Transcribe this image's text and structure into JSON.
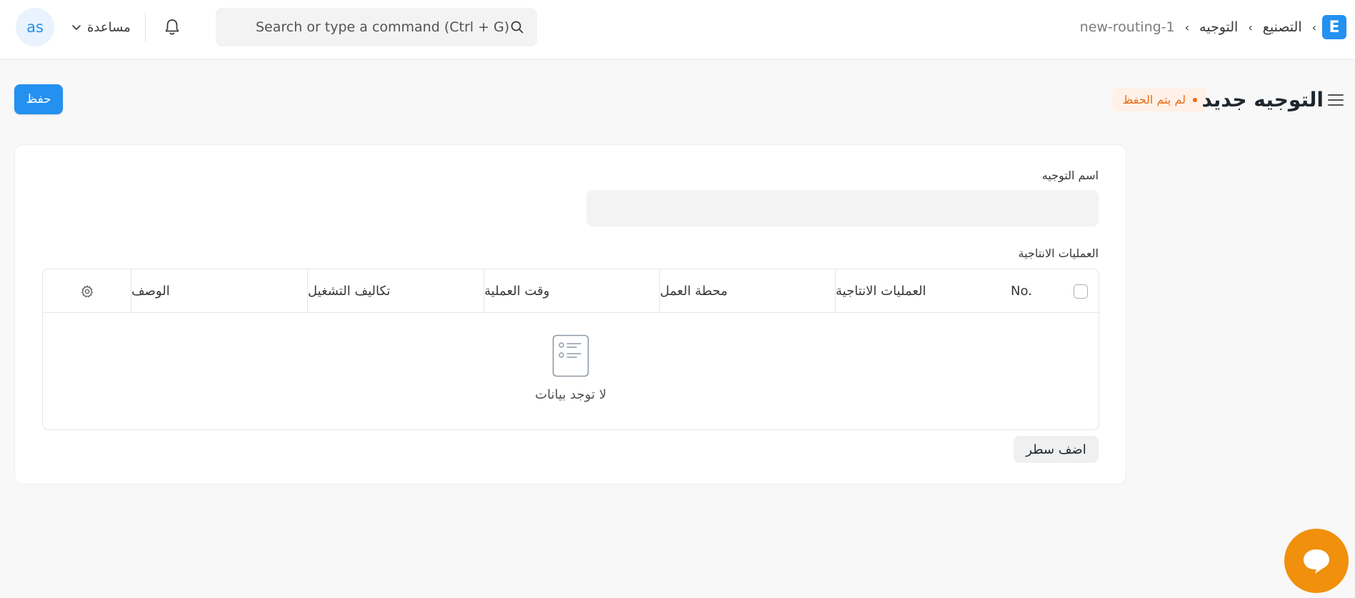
{
  "navbar": {
    "avatar_initials": "as",
    "help_label": "مساعدة",
    "search_placeholder": "Search or type a command (Ctrl + G)",
    "breadcrumbs": [
      "التصنيع",
      "التوجيه",
      "new-routing-1"
    ],
    "app_logo_letter": "E",
    "accent_color": "#2490ef"
  },
  "page": {
    "title": "التوجيه جديد",
    "status": "لم يتم الحفظ",
    "save_label": "حفظ"
  },
  "form": {
    "routing_name_label": "اسم التوجيه",
    "routing_name_value": "",
    "operations_label": "العمليات الانتاجية",
    "table": {
      "columns": [
        "No.",
        "العمليات الانتاجية",
        "محطة العمل",
        "وقت العملية",
        "تكاليف التشغيل",
        "الوصف"
      ],
      "rows": [],
      "empty_text": "لا توجد بيانات"
    },
    "add_row_label": "اضف سطر"
  },
  "chat": {
    "color": "#f0900c"
  }
}
